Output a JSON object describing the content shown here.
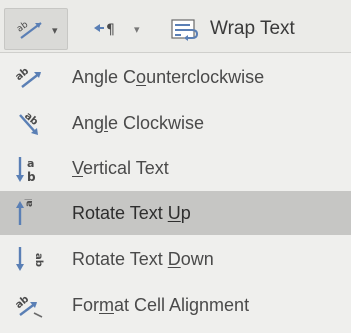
{
  "ribbon": {
    "orientation_icon": "orientation-abc-diagonal-icon",
    "text_direction_icon": "right-to-left-paragraph-icon",
    "wrap_text_icon": "wrap-text-icon",
    "wrap_text_label": "Wrap Text",
    "dropdown_glyph": "▾"
  },
  "menu": {
    "items": [
      {
        "icon": "angle-counterclockwise-icon",
        "before": "Angle C",
        "accel": "o",
        "after": "unterclockwise",
        "highlighted": false
      },
      {
        "icon": "angle-clockwise-icon",
        "before": "Ang",
        "accel": "l",
        "after": "e Clockwise",
        "highlighted": false
      },
      {
        "icon": "vertical-text-icon",
        "before": "",
        "accel": "V",
        "after": "ertical Text",
        "highlighted": false
      },
      {
        "icon": "rotate-text-up-icon",
        "before": "Rotate Text ",
        "accel": "U",
        "after": "p",
        "highlighted": true
      },
      {
        "icon": "rotate-text-down-icon",
        "before": "Rotate Text ",
        "accel": "D",
        "after": "own",
        "highlighted": false
      },
      {
        "icon": "format-cell-alignment-icon",
        "before": "For",
        "accel": "m",
        "after": "at Cell Alignment",
        "highlighted": false
      }
    ]
  },
  "colors": {
    "highlight": "#c6c6c4",
    "icon_blue": "#5a7fb5",
    "text": "#4a4a4a"
  }
}
